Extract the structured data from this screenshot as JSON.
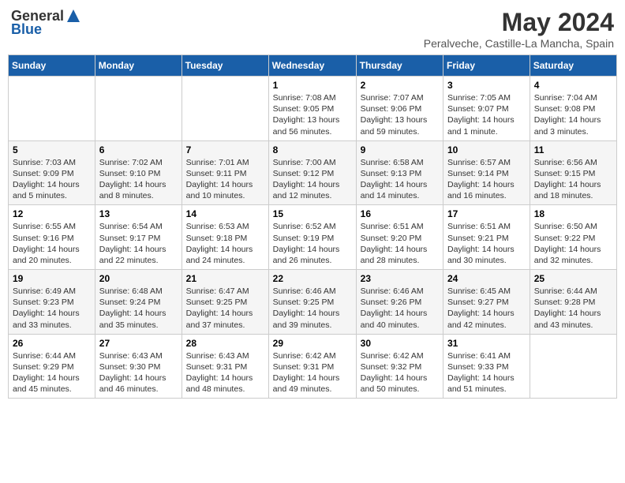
{
  "logo": {
    "general": "General",
    "blue": "Blue"
  },
  "title": {
    "month_year": "May 2024",
    "location": "Peralveche, Castille-La Mancha, Spain"
  },
  "weekdays": [
    "Sunday",
    "Monday",
    "Tuesday",
    "Wednesday",
    "Thursday",
    "Friday",
    "Saturday"
  ],
  "weeks": [
    [
      {
        "day": "",
        "info": ""
      },
      {
        "day": "",
        "info": ""
      },
      {
        "day": "",
        "info": ""
      },
      {
        "day": "1",
        "info": "Sunrise: 7:08 AM\nSunset: 9:05 PM\nDaylight: 13 hours\nand 56 minutes."
      },
      {
        "day": "2",
        "info": "Sunrise: 7:07 AM\nSunset: 9:06 PM\nDaylight: 13 hours\nand 59 minutes."
      },
      {
        "day": "3",
        "info": "Sunrise: 7:05 AM\nSunset: 9:07 PM\nDaylight: 14 hours\nand 1 minute."
      },
      {
        "day": "4",
        "info": "Sunrise: 7:04 AM\nSunset: 9:08 PM\nDaylight: 14 hours\nand 3 minutes."
      }
    ],
    [
      {
        "day": "5",
        "info": "Sunrise: 7:03 AM\nSunset: 9:09 PM\nDaylight: 14 hours\nand 5 minutes."
      },
      {
        "day": "6",
        "info": "Sunrise: 7:02 AM\nSunset: 9:10 PM\nDaylight: 14 hours\nand 8 minutes."
      },
      {
        "day": "7",
        "info": "Sunrise: 7:01 AM\nSunset: 9:11 PM\nDaylight: 14 hours\nand 10 minutes."
      },
      {
        "day": "8",
        "info": "Sunrise: 7:00 AM\nSunset: 9:12 PM\nDaylight: 14 hours\nand 12 minutes."
      },
      {
        "day": "9",
        "info": "Sunrise: 6:58 AM\nSunset: 9:13 PM\nDaylight: 14 hours\nand 14 minutes."
      },
      {
        "day": "10",
        "info": "Sunrise: 6:57 AM\nSunset: 9:14 PM\nDaylight: 14 hours\nand 16 minutes."
      },
      {
        "day": "11",
        "info": "Sunrise: 6:56 AM\nSunset: 9:15 PM\nDaylight: 14 hours\nand 18 minutes."
      }
    ],
    [
      {
        "day": "12",
        "info": "Sunrise: 6:55 AM\nSunset: 9:16 PM\nDaylight: 14 hours\nand 20 minutes."
      },
      {
        "day": "13",
        "info": "Sunrise: 6:54 AM\nSunset: 9:17 PM\nDaylight: 14 hours\nand 22 minutes."
      },
      {
        "day": "14",
        "info": "Sunrise: 6:53 AM\nSunset: 9:18 PM\nDaylight: 14 hours\nand 24 minutes."
      },
      {
        "day": "15",
        "info": "Sunrise: 6:52 AM\nSunset: 9:19 PM\nDaylight: 14 hours\nand 26 minutes."
      },
      {
        "day": "16",
        "info": "Sunrise: 6:51 AM\nSunset: 9:20 PM\nDaylight: 14 hours\nand 28 minutes."
      },
      {
        "day": "17",
        "info": "Sunrise: 6:51 AM\nSunset: 9:21 PM\nDaylight: 14 hours\nand 30 minutes."
      },
      {
        "day": "18",
        "info": "Sunrise: 6:50 AM\nSunset: 9:22 PM\nDaylight: 14 hours\nand 32 minutes."
      }
    ],
    [
      {
        "day": "19",
        "info": "Sunrise: 6:49 AM\nSunset: 9:23 PM\nDaylight: 14 hours\nand 33 minutes."
      },
      {
        "day": "20",
        "info": "Sunrise: 6:48 AM\nSunset: 9:24 PM\nDaylight: 14 hours\nand 35 minutes."
      },
      {
        "day": "21",
        "info": "Sunrise: 6:47 AM\nSunset: 9:25 PM\nDaylight: 14 hours\nand 37 minutes."
      },
      {
        "day": "22",
        "info": "Sunrise: 6:46 AM\nSunset: 9:25 PM\nDaylight: 14 hours\nand 39 minutes."
      },
      {
        "day": "23",
        "info": "Sunrise: 6:46 AM\nSunset: 9:26 PM\nDaylight: 14 hours\nand 40 minutes."
      },
      {
        "day": "24",
        "info": "Sunrise: 6:45 AM\nSunset: 9:27 PM\nDaylight: 14 hours\nand 42 minutes."
      },
      {
        "day": "25",
        "info": "Sunrise: 6:44 AM\nSunset: 9:28 PM\nDaylight: 14 hours\nand 43 minutes."
      }
    ],
    [
      {
        "day": "26",
        "info": "Sunrise: 6:44 AM\nSunset: 9:29 PM\nDaylight: 14 hours\nand 45 minutes."
      },
      {
        "day": "27",
        "info": "Sunrise: 6:43 AM\nSunset: 9:30 PM\nDaylight: 14 hours\nand 46 minutes."
      },
      {
        "day": "28",
        "info": "Sunrise: 6:43 AM\nSunset: 9:31 PM\nDaylight: 14 hours\nand 48 minutes."
      },
      {
        "day": "29",
        "info": "Sunrise: 6:42 AM\nSunset: 9:31 PM\nDaylight: 14 hours\nand 49 minutes."
      },
      {
        "day": "30",
        "info": "Sunrise: 6:42 AM\nSunset: 9:32 PM\nDaylight: 14 hours\nand 50 minutes."
      },
      {
        "day": "31",
        "info": "Sunrise: 6:41 AM\nSunset: 9:33 PM\nDaylight: 14 hours\nand 51 minutes."
      },
      {
        "day": "",
        "info": ""
      }
    ]
  ]
}
